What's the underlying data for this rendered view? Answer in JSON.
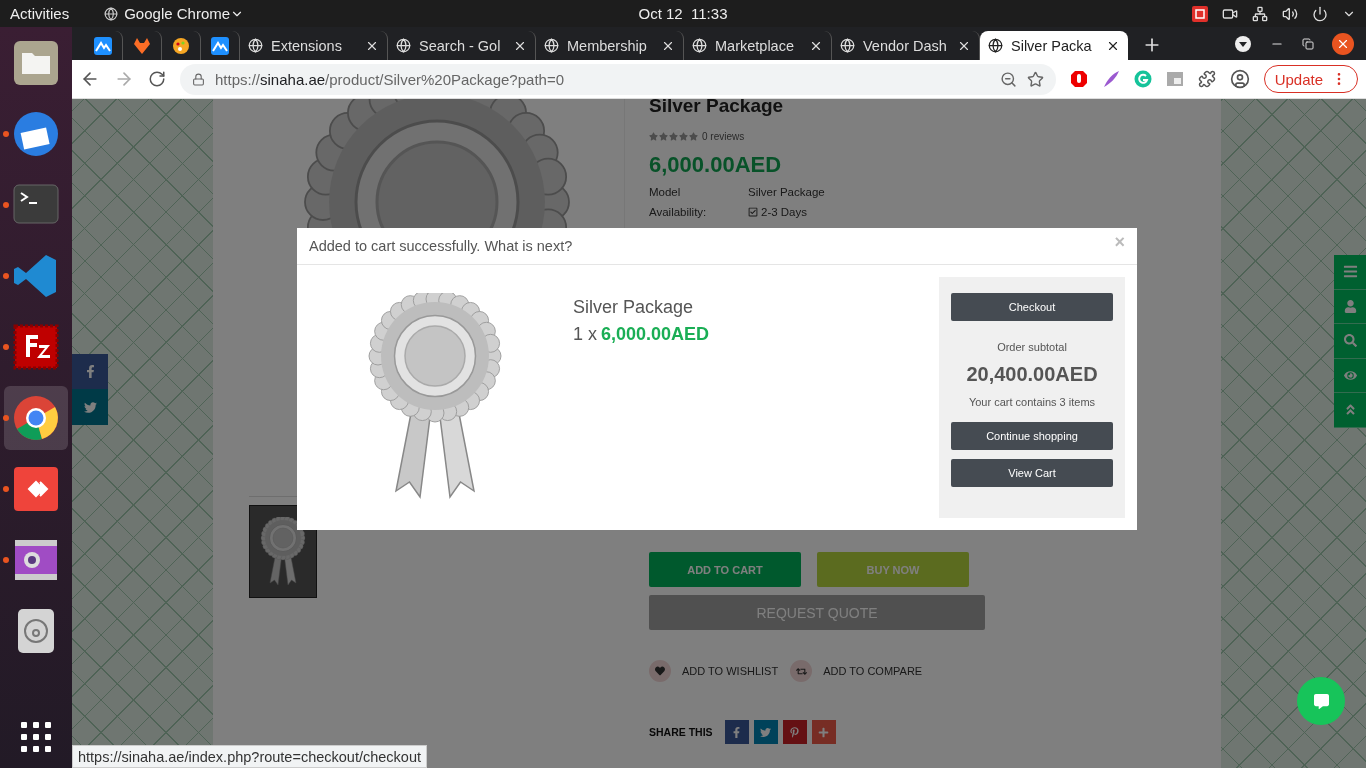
{
  "topbar": {
    "activities": "Activities",
    "app": "Google Chrome",
    "clock": "Oct 12  11:33"
  },
  "dock": [
    {
      "kind": "files",
      "running": false,
      "selected": false
    },
    {
      "kind": "mail",
      "running": true,
      "selected": false
    },
    {
      "kind": "terminal",
      "running": true,
      "selected": false
    },
    {
      "kind": "code",
      "running": true,
      "selected": false
    },
    {
      "kind": "ftp",
      "running": true,
      "selected": false
    },
    {
      "kind": "browser",
      "running": true,
      "selected": true
    },
    {
      "kind": "remote",
      "running": true,
      "selected": false
    },
    {
      "kind": "video",
      "running": true,
      "selected": false
    },
    {
      "kind": "disc",
      "running": false,
      "selected": false
    }
  ],
  "tabs": [
    {
      "kind": "mountain",
      "selected": false
    },
    {
      "kind": "fox",
      "selected": false
    },
    {
      "kind": "palette",
      "selected": false
    },
    {
      "kind": "mountain",
      "selected": false
    },
    {
      "kind": "page",
      "title": "Extensions",
      "selected": false
    },
    {
      "kind": "page",
      "title": "Search - Gol",
      "selected": false
    },
    {
      "kind": "page",
      "title": "Membership",
      "selected": false
    },
    {
      "kind": "page",
      "title": "Marketplace",
      "selected": false
    },
    {
      "kind": "page",
      "title": "Vendor Dash",
      "selected": false
    },
    {
      "kind": "page",
      "title": "Silver Packa",
      "selected": true
    }
  ],
  "address": {
    "scheme": "https://",
    "domain": "sinaha.ae",
    "path": "/product/Silver%20Package?path=0"
  },
  "update_button": "Update",
  "product": {
    "title": "Silver Package",
    "stars": 0,
    "reviews": "0 reviews",
    "price": "6,000.00AED",
    "specs": [
      {
        "kind": "text",
        "label": "Model",
        "value": "Silver Package"
      },
      {
        "kind": "check",
        "label": "Availability:",
        "value": "2-3 Days"
      }
    ],
    "add_to_cart": "ADD TO CART",
    "buy_now": "BUY NOW",
    "request_quote": "REQUEST QUOTE",
    "links": [
      {
        "kind": "wishlist",
        "label": "ADD TO WISHLIST"
      },
      {
        "kind": "compare",
        "label": "ADD TO COMPARE"
      }
    ],
    "share_label": "SHARE THIS",
    "share": [
      {
        "kind": "facebook"
      },
      {
        "kind": "twitter"
      },
      {
        "kind": "pinterest"
      },
      {
        "kind": "more"
      }
    ]
  },
  "modal": {
    "heading": "Added to cart successfully. What is next?",
    "close": "×",
    "product": "Silver Package",
    "quantity": "1 x",
    "price": "6,000.00AED",
    "checkout": "Checkout",
    "subtotal_label": "Order subtotal",
    "subtotal": "20,400.00AED",
    "cart_note": "Your cart contains 3 items",
    "continue": "Continue shopping",
    "view_cart": "View Cart"
  },
  "status_url": "https://sinaha.ae/index.php?route=checkout/checkout"
}
